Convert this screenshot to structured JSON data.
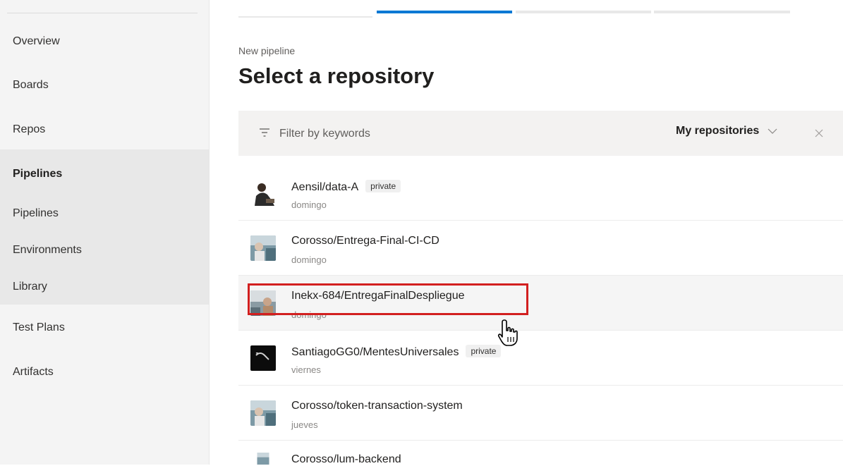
{
  "sidebar": {
    "items": [
      {
        "label": "Overview"
      },
      {
        "label": "Boards"
      },
      {
        "label": "Repos"
      },
      {
        "label": "Pipelines"
      },
      {
        "label": "Pipelines"
      },
      {
        "label": "Environments"
      },
      {
        "label": "Library"
      },
      {
        "label": "Test Plans"
      },
      {
        "label": "Artifacts"
      }
    ]
  },
  "header": {
    "subtitle": "New pipeline",
    "title": "Select a repository"
  },
  "filter": {
    "placeholder": "Filter by keywords",
    "scope": "My repositories"
  },
  "repos": [
    {
      "name": "Aensil/data-A",
      "badge": "private",
      "sub": "domingo"
    },
    {
      "name": "Corosso/Entrega-Final-CI-CD",
      "badge": "",
      "sub": "domingo"
    },
    {
      "name": "Inekx-684/EntregaFinalDespliegue",
      "badge": "",
      "sub": "domingo"
    },
    {
      "name": "SantiagoGG0/MentesUniversales",
      "badge": "private",
      "sub": "viernes"
    },
    {
      "name": "Corosso/token-transaction-system",
      "badge": "",
      "sub": "jueves"
    },
    {
      "name": "Corosso/lum-backend",
      "badge": "",
      "sub": ""
    }
  ],
  "colors": {
    "accent": "#0078d4",
    "highlight": "#d21f1f"
  }
}
